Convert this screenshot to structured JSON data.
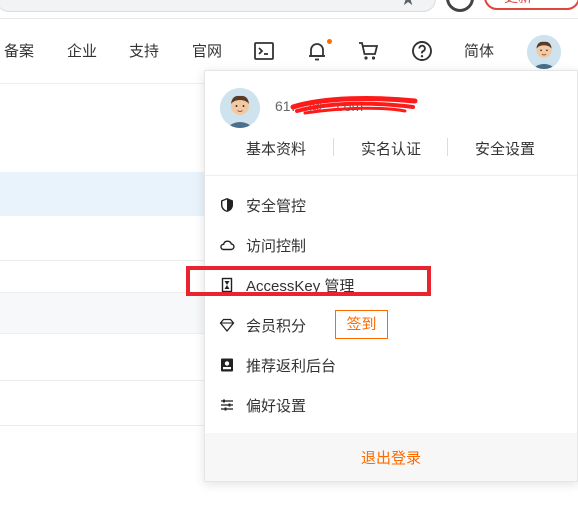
{
  "browser": {
    "update_label": "更新"
  },
  "topnav": {
    "items": [
      "备案",
      "企业",
      "支持",
      "官网"
    ],
    "language": "简体"
  },
  "account_menu": {
    "user_name": "61…  @…com",
    "quick_links": [
      "基本资料",
      "实名认证",
      "安全设置"
    ],
    "items": [
      {
        "icon": "shield-icon",
        "label": "安全管控"
      },
      {
        "icon": "cloud-icon",
        "label": "访问控制"
      },
      {
        "icon": "hourglass-icon",
        "label": "AccessKey 管理"
      },
      {
        "icon": "diamond-icon",
        "label": "会员积分"
      },
      {
        "icon": "id-card-icon",
        "label": "推荐返利后台"
      },
      {
        "icon": "sliders-icon",
        "label": "偏好设置"
      }
    ],
    "signin_label": "签到",
    "logout_label": "退出登录"
  },
  "colors": {
    "accent": "#ff6a00",
    "annotation": "#e8252f",
    "highlight_row": "#e9f3fc"
  }
}
